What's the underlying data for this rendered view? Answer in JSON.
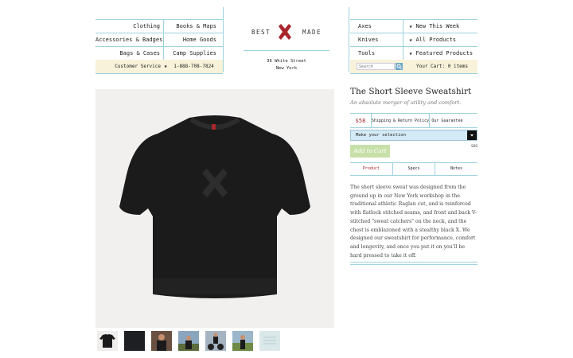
{
  "nav_left": {
    "rows": [
      {
        "left": "Clothing",
        "right": "Books & Maps"
      },
      {
        "left": "Accessories & Badges",
        "right": "Home Goods"
      },
      {
        "left": "Bags & Cases",
        "right": "Camp Supplies"
      }
    ],
    "customer_service_label": "Customer Service",
    "phone": "1-888-708-7824"
  },
  "logo": {
    "left_word": "BEST",
    "right_word": "MADE"
  },
  "address": {
    "line1": "36 White Street",
    "line2": "New York"
  },
  "nav_right": {
    "rows": [
      {
        "left": "Axes",
        "right": "New This Week"
      },
      {
        "left": "Knives",
        "right": "All Products"
      },
      {
        "left": "Tools",
        "right": "Featured Products"
      }
    ],
    "search_placeholder": "Search",
    "cart": "Your Cart: 0 items"
  },
  "product": {
    "title": "The Short Sleeve Sweatshirt",
    "subtitle": "An absolute merger of utility and comfort.",
    "price": "$58",
    "shipping_link": "Shipping & Return Policy",
    "guarantee_link": "Our Guarantee",
    "select_placeholder": "Make your selection",
    "sku": "SOS",
    "add_to_cart": "Add to Cart",
    "tabs": [
      "Product",
      "Specs",
      "Notes"
    ],
    "description": "The short sleeve sweat was designed from the ground up in our New York workshop in the traditional athletic Raglan cut, and is reinforced with flatlock stitched seams, and front and back V-stitched \"sweat catchers\" on the neck, and the chest is emblazoned with a stealthy black X. We designed our sweatshirt for performance, comfort and longevity, and once you put it on you'll be hard pressed to take it off."
  },
  "colors": {
    "accent_red": "#a8262c",
    "rule_blue": "#9fd3de",
    "cream": "#f7f2d9"
  },
  "thumbnails": [
    "tshirt-flat",
    "tshirt-dark",
    "model-front",
    "model-outdoor",
    "model-motorcycle",
    "model-field",
    "pattern-swatch"
  ]
}
